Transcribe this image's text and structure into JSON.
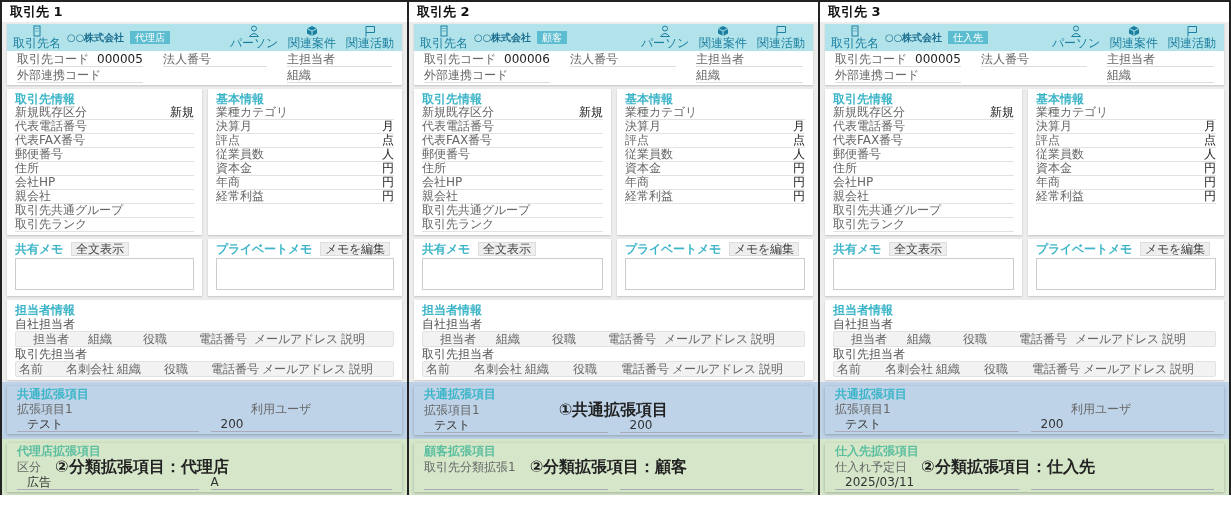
{
  "panels": [
    {
      "title": "取引先 1",
      "header": {
        "entity_label": "取引先名",
        "company": "○○株式会社",
        "badge": "代理店",
        "actions": [
          {
            "label": "パーソン",
            "kind": "person"
          },
          {
            "label": "関連案件",
            "kind": "cube"
          },
          {
            "label": "関連活動",
            "kind": "flag"
          }
        ],
        "fields": [
          {
            "label": "取引先コード",
            "value": "000005"
          },
          {
            "label": "法人番号"
          },
          {
            "label": "主担当者"
          },
          {
            "label": "外部連携コード"
          },
          {
            "label": "組織"
          }
        ]
      },
      "partner_info": {
        "title": "取引先情報",
        "rows": [
          {
            "label": "新規既存区分",
            "value": "新規"
          },
          {
            "label": "代表電話番号"
          },
          {
            "label": "代表FAX番号"
          },
          {
            "label": "郵便番号"
          },
          {
            "label": "住所"
          },
          {
            "label": "会社HP"
          },
          {
            "label": "親会社"
          },
          {
            "label": "取引先共通グループ"
          },
          {
            "label": "取引先ランク"
          }
        ]
      },
      "basic_info": {
        "title": "基本情報",
        "rows": [
          {
            "label": "業種カテゴリ"
          },
          {
            "label": "決算月",
            "value": "月"
          },
          {
            "label": "評点",
            "value": "点"
          },
          {
            "label": "従業員数",
            "value": "人"
          },
          {
            "label": "資本金",
            "value": "円"
          },
          {
            "label": "年商",
            "value": "円"
          },
          {
            "label": "経常利益",
            "value": "円"
          }
        ]
      },
      "shared_memo": {
        "title": "共有メモ",
        "button": "全文表示"
      },
      "private_memo": {
        "title": "プライベートメモ",
        "button": "メモを編集"
      },
      "contacts": {
        "title": "担当者情報",
        "tables": [
          {
            "title": "自社担当者",
            "kind": "select",
            "columns": [
              "担当者",
              "組織",
              "役職",
              "電話番号",
              "メールアドレス",
              "説明"
            ]
          },
          {
            "title": "取引先担当者",
            "kind": "plain",
            "columns": [
              "名前",
              "名刺会社",
              "組織",
              "役職",
              "電話番号",
              "メールアドレス",
              "説明"
            ]
          }
        ]
      },
      "common_ext": {
        "title": "共通拡張項目",
        "fields": [
          {
            "label": "拡張項目1",
            "value": "テスト"
          },
          {
            "label": "利用ユーザ",
            "value": "200"
          }
        ]
      },
      "class_ext": {
        "title": "代理店拡張項目",
        "callout": "②分類拡張項目：代理店",
        "fields": [
          {
            "label": "区分",
            "value": "広告"
          },
          {
            "value": "A"
          }
        ]
      }
    },
    {
      "title": "取引先 2",
      "header": {
        "entity_label": "取引先名",
        "company": "○○株式会社",
        "badge": "顧客",
        "actions": [
          {
            "label": "パーソン",
            "kind": "person"
          },
          {
            "label": "関連案件",
            "kind": "cube"
          },
          {
            "label": "関連活動",
            "kind": "flag"
          }
        ],
        "fields": [
          {
            "label": "取引先コード",
            "value": "000006"
          },
          {
            "label": "法人番号"
          },
          {
            "label": "主担当者"
          },
          {
            "label": "外部連携コード"
          },
          {
            "label": "組織"
          }
        ]
      },
      "partner_info": {
        "title": "取引先情報",
        "rows": [
          {
            "label": "新規既存区分",
            "value": "新規"
          },
          {
            "label": "代表電話番号"
          },
          {
            "label": "代表FAX番号"
          },
          {
            "label": "郵便番号"
          },
          {
            "label": "住所"
          },
          {
            "label": "会社HP"
          },
          {
            "label": "親会社"
          },
          {
            "label": "取引先共通グループ"
          },
          {
            "label": "取引先ランク"
          }
        ]
      },
      "basic_info": {
        "title": "基本情報",
        "rows": [
          {
            "label": "業種カテゴリ"
          },
          {
            "label": "決算月",
            "value": "月"
          },
          {
            "label": "評点",
            "value": "点"
          },
          {
            "label": "従業員数",
            "value": "人"
          },
          {
            "label": "資本金",
            "value": "円"
          },
          {
            "label": "年商",
            "value": "円"
          },
          {
            "label": "経常利益",
            "value": "円"
          }
        ]
      },
      "shared_memo": {
        "title": "共有メモ",
        "button": "全文表示"
      },
      "private_memo": {
        "title": "プライベートメモ",
        "button": "メモを編集"
      },
      "contacts": {
        "title": "担当者情報",
        "tables": [
          {
            "title": "自社担当者",
            "kind": "select",
            "columns": [
              "担当者",
              "組織",
              "役職",
              "電話番号",
              "メールアドレス",
              "説明"
            ]
          },
          {
            "title": "取引先担当者",
            "kind": "plain",
            "columns": [
              "名前",
              "名刺会社",
              "組織",
              "役職",
              "電話番号",
              "メールアドレス",
              "説明"
            ]
          }
        ]
      },
      "common_ext": {
        "title": "共通拡張項目",
        "callout": "①共通拡張項目",
        "fields": [
          {
            "label": "拡張項目1",
            "value": "テスト"
          },
          {
            "value": "200"
          }
        ]
      },
      "class_ext": {
        "title": "顧客拡張項目",
        "callout": "②分類拡張項目：顧客",
        "fields": [
          {
            "label": "取引先分類拡張1"
          }
        ]
      }
    },
    {
      "title": "取引先 3",
      "header": {
        "entity_label": "取引先名",
        "company": "○○株式会社",
        "badge": "仕入先",
        "actions": [
          {
            "label": "パーソン",
            "kind": "person"
          },
          {
            "label": "関連案件",
            "kind": "cube"
          },
          {
            "label": "関連活動",
            "kind": "flag"
          }
        ],
        "fields": [
          {
            "label": "取引先コード",
            "value": "000005"
          },
          {
            "label": "法人番号"
          },
          {
            "label": "主担当者"
          },
          {
            "label": "外部連携コード"
          },
          {
            "label": "組織"
          }
        ]
      },
      "partner_info": {
        "title": "取引先情報",
        "rows": [
          {
            "label": "新規既存区分",
            "value": "新規"
          },
          {
            "label": "代表電話番号"
          },
          {
            "label": "代表FAX番号"
          },
          {
            "label": "郵便番号"
          },
          {
            "label": "住所"
          },
          {
            "label": "会社HP"
          },
          {
            "label": "親会社"
          },
          {
            "label": "取引先共通グループ"
          },
          {
            "label": "取引先ランク"
          }
        ]
      },
      "basic_info": {
        "title": "基本情報",
        "rows": [
          {
            "label": "業種カテゴリ"
          },
          {
            "label": "決算月",
            "value": "月"
          },
          {
            "label": "評点",
            "value": "点"
          },
          {
            "label": "従業員数",
            "value": "人"
          },
          {
            "label": "資本金",
            "value": "円"
          },
          {
            "label": "年商",
            "value": "円"
          },
          {
            "label": "経常利益",
            "value": "円"
          }
        ]
      },
      "shared_memo": {
        "title": "共有メモ",
        "button": "全文表示"
      },
      "private_memo": {
        "title": "プライベートメモ",
        "button": "メモを編集"
      },
      "contacts": {
        "title": "担当者情報",
        "tables": [
          {
            "title": "自社担当者",
            "kind": "select",
            "columns": [
              "担当者",
              "組織",
              "役職",
              "電話番号",
              "メールアドレス",
              "説明"
            ]
          },
          {
            "title": "取引先担当者",
            "kind": "plain",
            "columns": [
              "名前",
              "名刺会社",
              "組織",
              "役職",
              "電話番号",
              "メールアドレス",
              "説明"
            ]
          }
        ]
      },
      "common_ext": {
        "title": "共通拡張項目",
        "fields": [
          {
            "label": "拡張項目1",
            "value": "テスト"
          },
          {
            "label": "利用ユーザ",
            "value": "200"
          }
        ]
      },
      "class_ext": {
        "title": "仕入先拡張項目",
        "callout": "②分類拡張項目：仕入先",
        "fields": [
          {
            "label": "仕入れ予定日",
            "value": "2025/03/11"
          }
        ]
      }
    }
  ]
}
